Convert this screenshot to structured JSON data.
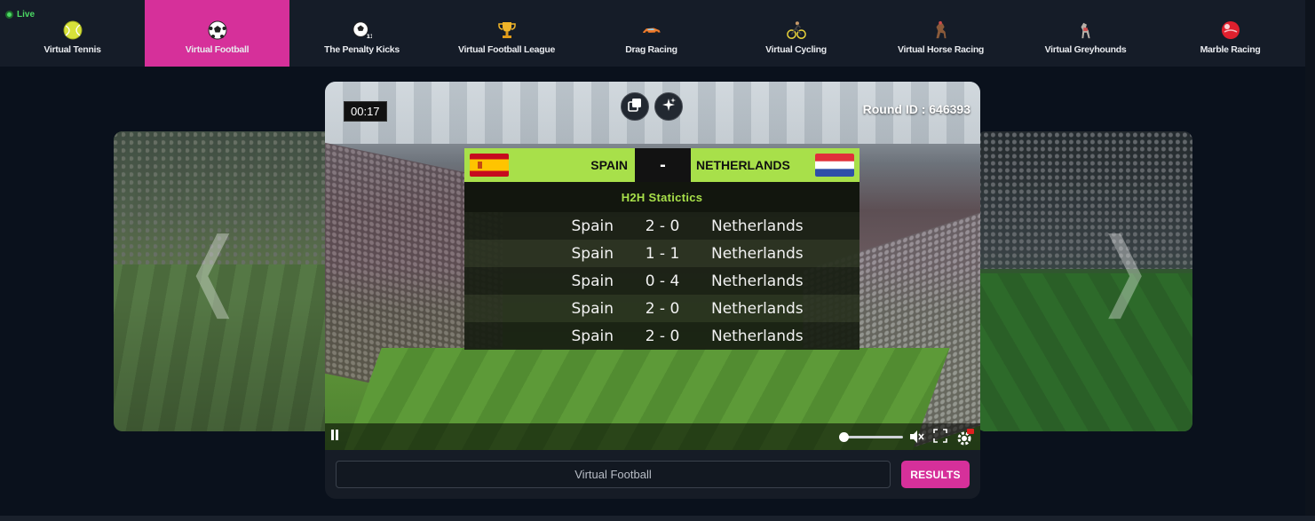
{
  "nav": {
    "live_label": "Live",
    "items": [
      {
        "label": "Virtual Tennis",
        "icon": "tennis-ball-icon"
      },
      {
        "label": "Virtual Football",
        "icon": "soccer-ball-icon",
        "active": true
      },
      {
        "label": "The Penalty Kicks",
        "icon": "penalty-ball-icon"
      },
      {
        "label": "Virtual Football League",
        "icon": "trophy-icon"
      },
      {
        "label": "Drag Racing",
        "icon": "race-car-icon"
      },
      {
        "label": "Virtual Cycling",
        "icon": "cyclist-icon"
      },
      {
        "label": "Virtual Horse Racing",
        "icon": "horse-icon"
      },
      {
        "label": "Virtual Greyhounds",
        "icon": "greyhound-icon"
      },
      {
        "label": "Marble Racing",
        "icon": "marble-icon"
      }
    ]
  },
  "player": {
    "timer": "00:17",
    "round_id": "Round ID : 646393",
    "match": {
      "home": "SPAIN",
      "away": "NETHERLANDS",
      "score": "-"
    },
    "h2h_title": "H2H Statictics",
    "h2h": [
      {
        "home": "Spain",
        "score": "2 - 0",
        "away": "Netherlands"
      },
      {
        "home": "Spain",
        "score": "1 - 1",
        "away": "Netherlands"
      },
      {
        "home": "Spain",
        "score": "0 - 4",
        "away": "Netherlands"
      },
      {
        "home": "Spain",
        "score": "2 - 0",
        "away": "Netherlands"
      },
      {
        "home": "Spain",
        "score": "2 - 0",
        "away": "Netherlands"
      }
    ],
    "volume_level": 0,
    "muted": true
  },
  "bottom": {
    "game_label": "Virtual Football",
    "results_label": "RESULTS"
  },
  "colors": {
    "accent": "#d6309a",
    "scoreboard_green": "#a8e04a",
    "background": "#0a111c"
  }
}
